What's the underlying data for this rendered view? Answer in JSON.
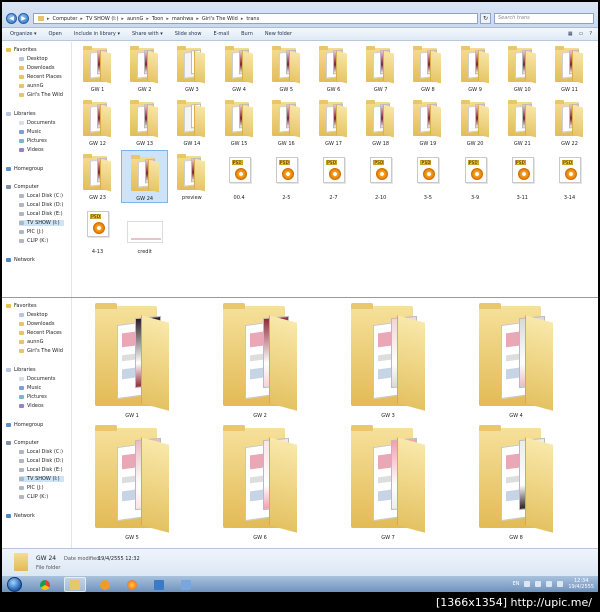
{
  "address": {
    "crumbs": [
      "Computer",
      "TV SHOW (I:)",
      "aunnG",
      "Toon",
      "manhwa",
      "Girl's The Wild",
      "trans"
    ],
    "search_placeholder": "Search trans"
  },
  "toolbar": {
    "organize": "Organize ▾",
    "open": "Open",
    "include": "Include in library ▾",
    "share": "Share with ▾",
    "slideshow": "Slide show",
    "email": "E-mail",
    "burn": "Burn",
    "newfolder": "New folder"
  },
  "nav": {
    "favorites": "Favorites",
    "desktop": "Desktop",
    "downloads": "Downloads",
    "recent": "Recent Places",
    "aunng": "aunnG",
    "girls": "Girl's The Wild",
    "libraries": "Libraries",
    "documents": "Documents",
    "music": "Music",
    "pictures": "Pictures",
    "videos": "Videos",
    "homegroup": "Homegroup",
    "computer": "Computer",
    "diskc": "Local Disk (C:)",
    "diskd": "Local Disk (D:)",
    "diske": "Local Disk (E:)",
    "tvshow": "TV SHOW (I:)",
    "pic": "PIC (J:)",
    "clip": "CLIP (K:)",
    "network": "Network"
  },
  "upper_items": [
    {
      "label": "GW 1"
    },
    {
      "label": "GW 2"
    },
    {
      "label": "GW 3"
    },
    {
      "label": "GW 4"
    },
    {
      "label": "GW 5"
    },
    {
      "label": "GW 6"
    },
    {
      "label": "GW 7"
    },
    {
      "label": "GW 8"
    },
    {
      "label": "GW 9"
    },
    {
      "label": "GW 10"
    },
    {
      "label": "GW 11"
    },
    {
      "label": "GW 12"
    },
    {
      "label": "GW 13"
    },
    {
      "label": "GW 14"
    },
    {
      "label": "GW 15"
    },
    {
      "label": "GW 16"
    },
    {
      "label": "GW 17"
    },
    {
      "label": "GW 18"
    },
    {
      "label": "GW 19"
    },
    {
      "label": "GW 20"
    },
    {
      "label": "GW 21"
    },
    {
      "label": "GW 22"
    },
    {
      "label": "GW 23"
    },
    {
      "label": "GW 24"
    },
    {
      "label": "preview"
    },
    {
      "label": "00.4"
    },
    {
      "label": "2-5"
    },
    {
      "label": "2-7"
    },
    {
      "label": "2-10"
    },
    {
      "label": "3-5"
    },
    {
      "label": "3-9"
    },
    {
      "label": "3-11"
    },
    {
      "label": "3-14"
    },
    {
      "label": "4-13"
    },
    {
      "label": "credit"
    }
  ],
  "lower_items": [
    {
      "label": "GW 1"
    },
    {
      "label": "GW 2"
    },
    {
      "label": "GW 3"
    },
    {
      "label": "GW 4"
    },
    {
      "label": "GW 5"
    },
    {
      "label": "GW 6"
    },
    {
      "label": "GW 7"
    },
    {
      "label": "GW 8"
    }
  ],
  "details": {
    "name": "GW 24",
    "modified_label": "Date modified:",
    "modified_value": "19/4/2555 12:32",
    "type": "File folder"
  },
  "taskbar": {
    "lang": "EN",
    "time": "12:34",
    "date": "19/4/2555"
  },
  "caption": "[1366x1354] http://upic.me/"
}
